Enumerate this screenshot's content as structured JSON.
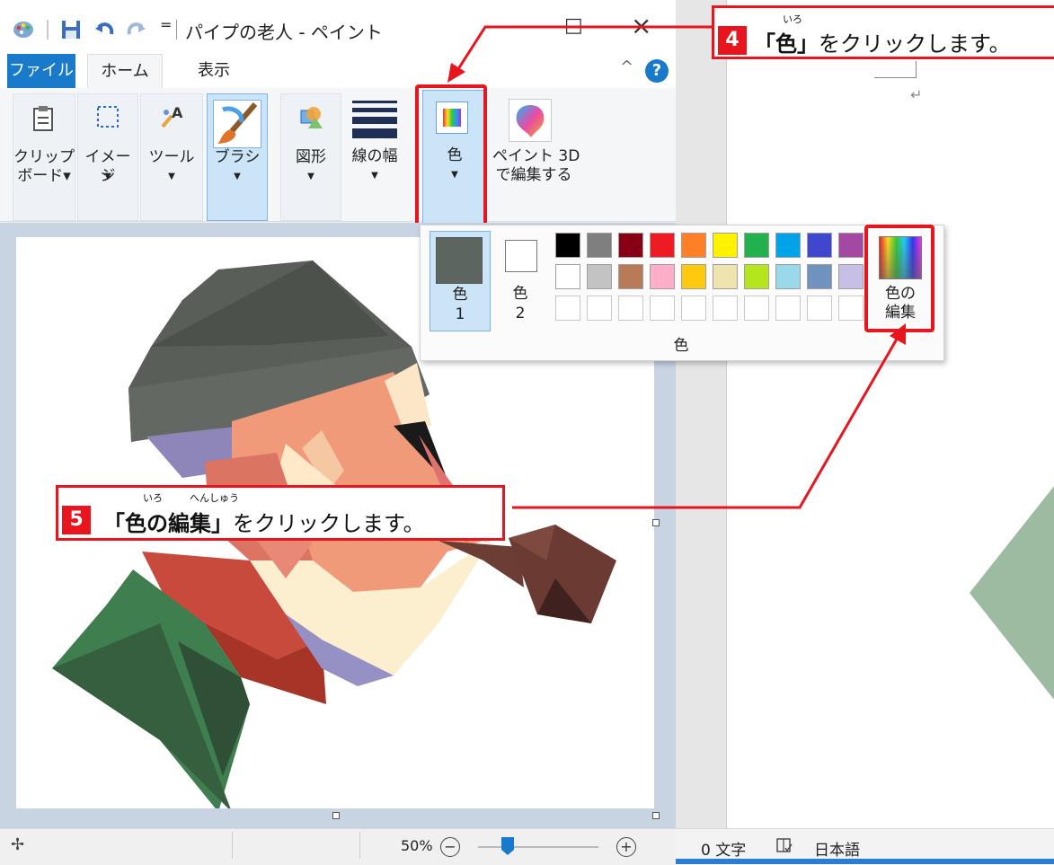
{
  "window": {
    "title": "パイプの老人 - ペイント",
    "qa_separator": "=",
    "restore_icon": "□",
    "close_icon": "×"
  },
  "menu": {
    "file": "ファイル",
    "home": "ホーム",
    "view": "表示",
    "collapse": "^",
    "help": "?"
  },
  "ribbon": {
    "clipboard": "クリップ\nボード▾",
    "image": "イメージ",
    "tools": "ツール",
    "brush": "ブラシ",
    "shapes": "図形",
    "line_width": "線の幅",
    "color": "色",
    "paint3d": "ペイント 3D\nで編集する",
    "dropdown_arrow": "▼"
  },
  "colors": {
    "color1_label": "色",
    "color1_num": "1",
    "color2_label": "色",
    "color2_num": "2",
    "group_label": "色",
    "edit_colors": "色の\n編集",
    "color1_value": "#5d6560",
    "row1": [
      "#000000",
      "#7f7f7f",
      "#880015",
      "#ed1c24",
      "#ff7f27",
      "#fff200",
      "#22b14c",
      "#00a2e8",
      "#3f48cc",
      "#a349a4"
    ],
    "row2": [
      "#ffffff",
      "#c3c3c3",
      "#b97a57",
      "#ffaec9",
      "#ffc90e",
      "#efe4b0",
      "#b5e61d",
      "#99d9ea",
      "#7092be",
      "#c8bfe7"
    ]
  },
  "status": {
    "zoom": "50%",
    "minus": "−",
    "plus": "+",
    "move_icon": "✢"
  },
  "doc": {
    "char_count": "0 文字",
    "language": "日本語",
    "return_mark": "↵"
  },
  "callouts": {
    "step4_num": "4",
    "step4_ruby": "いろ",
    "step4_text_1": "「色」",
    "step4_text_2": "をクリックします。",
    "step5_num": "5",
    "step5_ruby_1": "いろ",
    "step5_ruby_2": "へんしゅう",
    "step5_text_1": "「色の編集」",
    "step5_text_2": "をクリックします。"
  }
}
